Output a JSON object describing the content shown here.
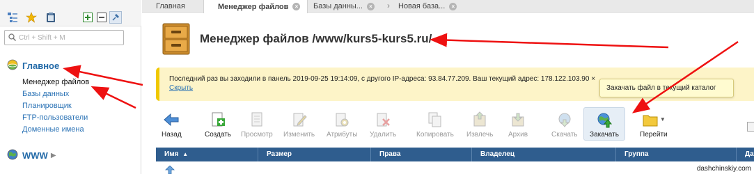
{
  "sidebar": {
    "search_placeholder": "Ctrl + Shift + M",
    "section_main": "Главное",
    "items": [
      {
        "label": "Менеджер файлов"
      },
      {
        "label": "Базы данных"
      },
      {
        "label": "Планировщик"
      },
      {
        "label": "FTP-пользователи"
      },
      {
        "label": "Доменные имена"
      }
    ],
    "section_www": "WWW"
  },
  "tabs": [
    {
      "label": "Главная"
    },
    {
      "label": "Менеджер файлов"
    },
    {
      "label": "Базы данны..."
    },
    {
      "label": "Новая база..."
    }
  ],
  "header": {
    "title": "Менеджер файлов /www/kurs5-kurs5.ru/"
  },
  "notice": {
    "text": "Последний раз вы заходили в панель 2019-09-25 19:14:09, с другого IP-адреса: 93.84.77.209. Ваш текущий адрес: 178.122.103.90 ×",
    "hide": "Скрыть"
  },
  "tooltip": "Закачать файл в текущий каталог",
  "toolbar": {
    "back": "Назад",
    "create": "Создать",
    "view": "Просмотр",
    "edit": "Изменить",
    "attributes": "Атрибуты",
    "delete": "Удалить",
    "copy": "Копировать",
    "extract": "Извлечь",
    "archive": "Архив",
    "download": "Скачать",
    "upload": "Закачать",
    "goto": "Перейти"
  },
  "table": {
    "columns": [
      "Имя",
      "Размер",
      "Права",
      "Владелец",
      "Группа",
      "Дата"
    ]
  },
  "watermark": "dashchinskiy.com"
}
